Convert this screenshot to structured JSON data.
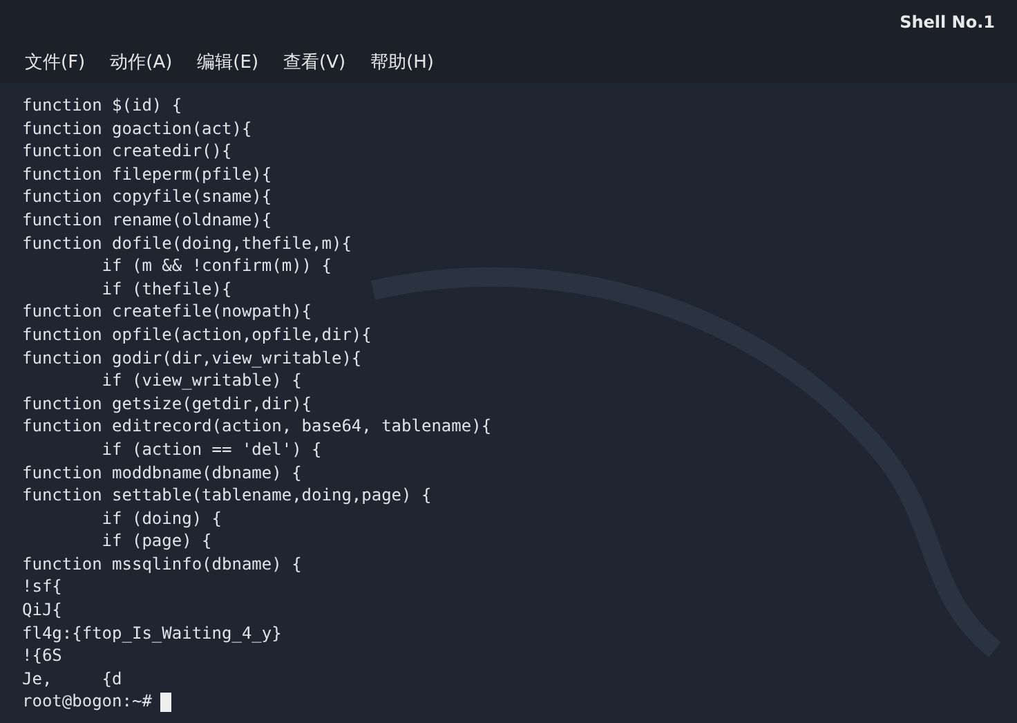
{
  "window": {
    "title": "Shell No.1"
  },
  "menu": [
    "文件(F)",
    "动作(A)",
    "编辑(E)",
    "查看(V)",
    "帮助(H)"
  ],
  "terminal": {
    "lines": [
      "function $(id) {",
      "function goaction(act){",
      "function createdir(){",
      "function fileperm(pfile){",
      "function copyfile(sname){",
      "function rename(oldname){",
      "function dofile(doing,thefile,m){",
      "        if (m && !confirm(m)) {",
      "        if (thefile){",
      "function createfile(nowpath){",
      "function opfile(action,opfile,dir){",
      "function godir(dir,view_writable){",
      "        if (view_writable) {",
      "function getsize(getdir,dir){",
      "function editrecord(action, base64, tablename){",
      "        if (action == 'del') {",
      "function moddbname(dbname) {",
      "function settable(tablename,doing,page) {",
      "        if (doing) {",
      "        if (page) {",
      "function mssqlinfo(dbname) {",
      "!sf{",
      "QiJ{",
      "fl4g:{ftop_Is_Waiting_4_y}",
      "!{6S",
      "Je,     {d"
    ],
    "prompt": "root@bogon:~#"
  }
}
